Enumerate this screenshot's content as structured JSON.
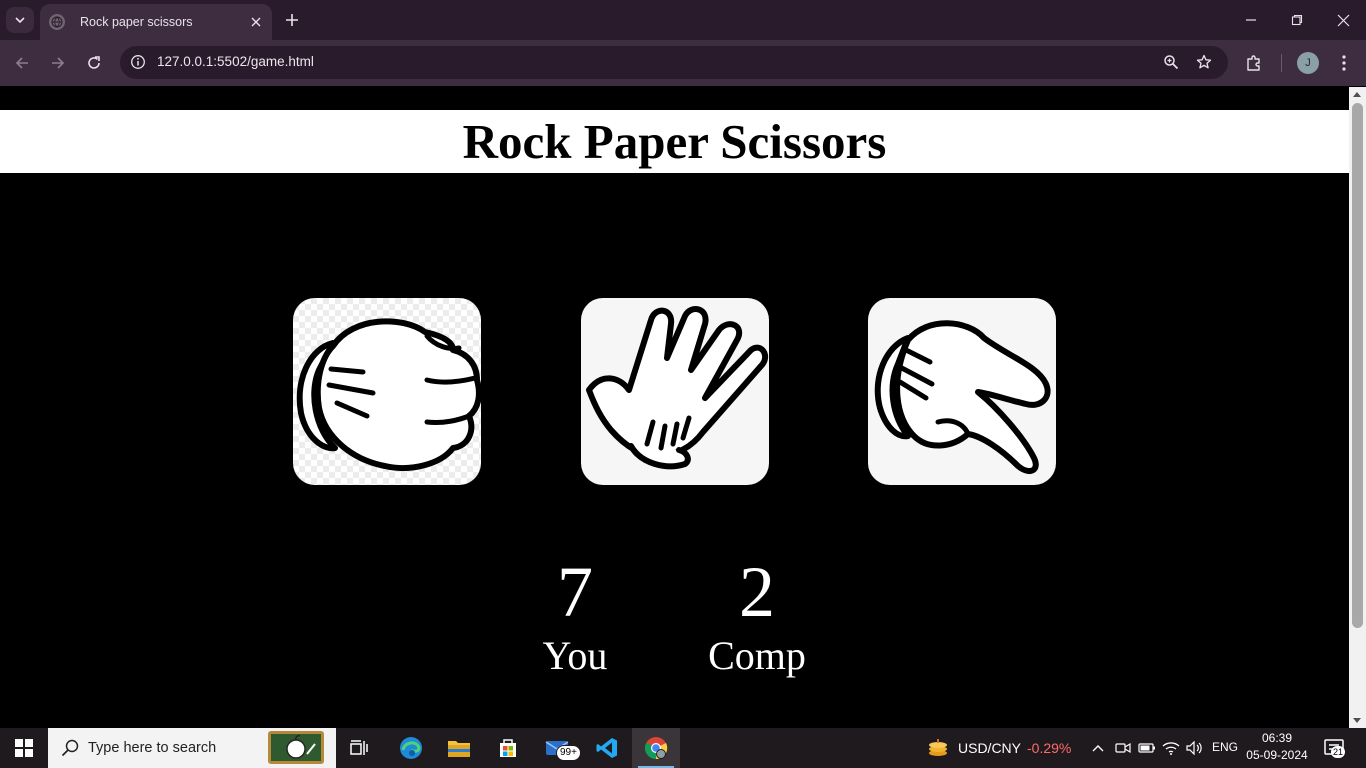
{
  "browser": {
    "tab_title": "Rock paper scissors",
    "url": "127.0.0.1:5502/game.html",
    "profile_initial": "J"
  },
  "page": {
    "heading": "Rock Paper Scissors",
    "choices": [
      {
        "name": "rock",
        "icon": "fist-hand-icon"
      },
      {
        "name": "paper",
        "icon": "open-hand-icon"
      },
      {
        "name": "scissors",
        "icon": "scissors-hand-icon"
      }
    ],
    "user_score": "7",
    "user_label": "You",
    "comp_score": "2",
    "comp_label": "Comp"
  },
  "taskbar": {
    "search_placeholder": "Type here to search",
    "mail_badge": "99+",
    "currency_pair": "USD/CNY",
    "currency_change": "-0.29%",
    "currency_change_color": "#ff6b6b",
    "language": "ENG",
    "time": "06:39",
    "date": "05-09-2024",
    "notification_count": "21"
  }
}
